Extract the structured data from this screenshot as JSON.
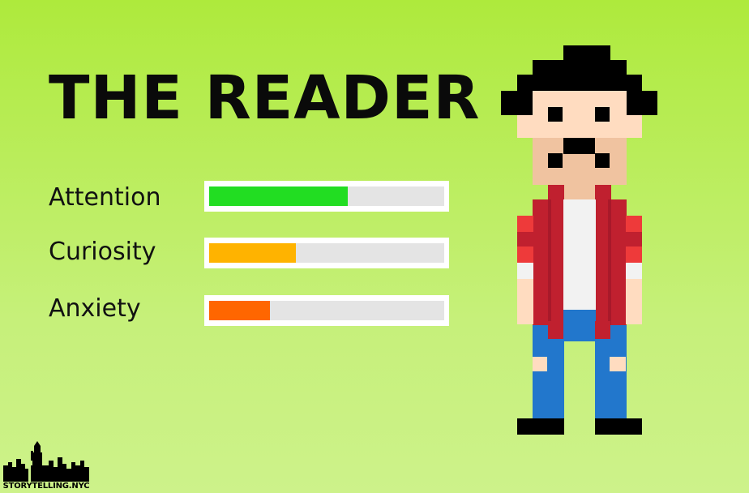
{
  "title": "THE READER",
  "meters": [
    {
      "label": "Attention",
      "value": 0.59,
      "color": "#22dd22"
    },
    {
      "label": "Curiosity",
      "value": 0.37,
      "color": "#ffb300"
    },
    {
      "label": "Anxiety",
      "value": 0.26,
      "color": "#ff6600"
    }
  ],
  "colors": {
    "background": "#aeea3c",
    "track": "#e4e4e4",
    "hat": "#000000",
    "skin": "#ffdcc0",
    "skin_shade": "#f0c3a0",
    "jacket": "#c0202f",
    "jacket_light": "#ee3a3a",
    "shirt": "#f2f2f2",
    "jeans": "#2277cc"
  },
  "character": {
    "icon": "pixel-reader-character-icon"
  },
  "logo": {
    "text": "STORYTELLING.NYC",
    "icon": "nyc-skyline-liberty-icon"
  }
}
